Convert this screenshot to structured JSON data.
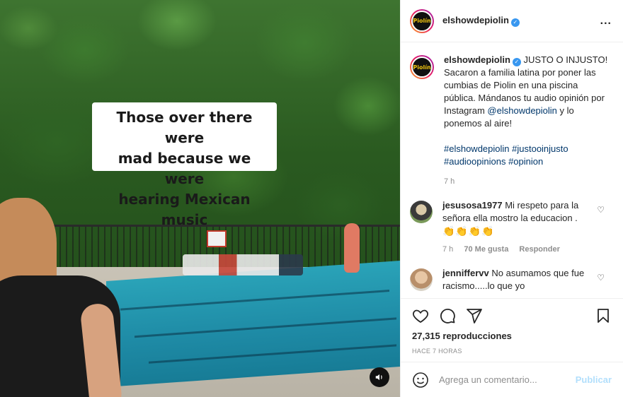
{
  "media": {
    "caption_lines": [
      "Those over there were",
      "mad because we were",
      "hearing Mexican music"
    ],
    "sound_icon": "speaker-icon"
  },
  "header": {
    "username": "elshowdepiolin",
    "avatar_text": "Piolín",
    "verified_icon": "verified-badge-icon",
    "more_icon": "more-options-icon",
    "more_glyph": "..."
  },
  "post_caption": {
    "username": "elshowdepiolin",
    "text_before_mention": " JUSTO O INJUSTO! Sacaron a familia latina por poner las cumbias de Piolin en una piscina pública. Mándanos tu audio opinión por Instagram ",
    "mention": "@elshowdepiolin",
    "text_after_mention": " y lo ponemos al aire!",
    "hashtags_line1": "#elshowdepiolin #justooinjusto",
    "hashtags_line2": "#audioopinions #opinion",
    "time": "7 h"
  },
  "comments": [
    {
      "username": "jesusosa1977",
      "text": "Mi respeto para la señora ella mostro la educacion .",
      "emoji": "👏👏👏👏",
      "time": "7 h",
      "likes": "70 Me gusta",
      "reply": "Responder"
    },
    {
      "username": "jenniffervv",
      "text": "No asumamos que fue racismo.....lo que yo"
    }
  ],
  "actions": {
    "like_icon": "heart-icon",
    "comment_icon": "comment-icon",
    "share_icon": "share-icon",
    "save_icon": "bookmark-icon",
    "views": "27,315 reproducciones",
    "posted_ago": "HACE 7 HORAS"
  },
  "add_comment": {
    "placeholder": "Agrega un comentario...",
    "publish": "Publicar"
  },
  "colors": {
    "link": "#00376b",
    "verified": "#3897f0",
    "publish_disabled": "#b2dffc",
    "muted": "#8e8e8e"
  }
}
